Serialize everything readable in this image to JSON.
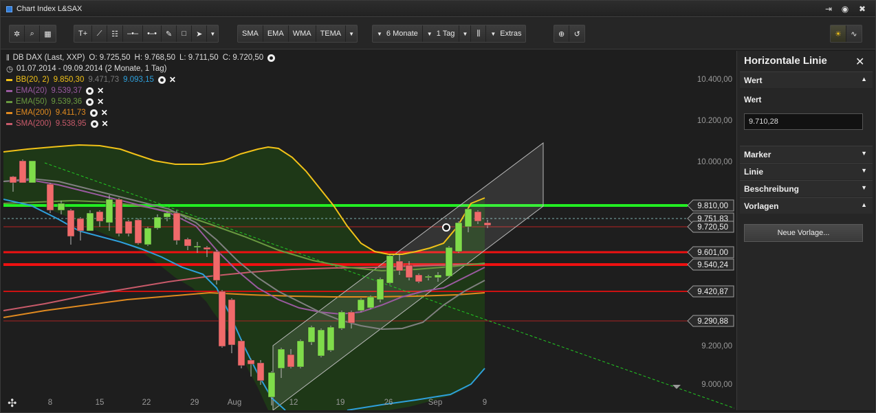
{
  "window": {
    "title": "Chart Index L&SAX",
    "buttons": [
      "export-icon",
      "target-icon",
      "close-icon"
    ]
  },
  "toolbar": {
    "tools": [
      "gear-icon",
      "search-icon",
      "grid-icon",
      "T+",
      "line-icon",
      "fibonacci-icon",
      "horizontal-line-icon",
      "ray-icon",
      "pencil-icon",
      "rectangle-icon",
      "arrow-icon"
    ],
    "indicators": [
      "SMA",
      "EMA",
      "WMA",
      "TEMA"
    ],
    "period": "6 Monate",
    "interval": "1 Tag",
    "extras": "Extras"
  },
  "legend": {
    "instrument": {
      "name": "DB DAX (Last, XXP)",
      "o": "O: 9.725,50",
      "h": "H: 9.768,50",
      "l": "L: 9.711,50",
      "c": "C: 9.720,50"
    },
    "range": "01.07.2014 - 09.09.2014 (2 Monate, 1 Tag)",
    "indicators": [
      {
        "name": "BB(20, 2)",
        "values": [
          "9.850,30",
          "9.471,73",
          "9.093,15"
        ],
        "colors": [
          "#f2c218",
          "#7a7a7a",
          "#2ea0dc"
        ],
        "color": "#f2c218"
      },
      {
        "name": "EMA(20)",
        "values": [
          "9.539,37"
        ],
        "color": "#9a5aa0"
      },
      {
        "name": "EMA(50)",
        "values": [
          "9.539,36"
        ],
        "color": "#6a9a40"
      },
      {
        "name": "EMA(200)",
        "values": [
          "9.411,73"
        ],
        "color": "#e08a20"
      },
      {
        "name": "SMA(200)",
        "values": [
          "9.538,95"
        ],
        "color": "#c85a6a"
      }
    ]
  },
  "axis": {
    "y_labels": [
      "10.400,00",
      "10.200,00",
      "10.000,00",
      "9.200,00",
      "9.000,00"
    ],
    "x_labels": [
      "8",
      "15",
      "22",
      "29",
      "Aug",
      "12",
      "19",
      "26",
      "Sep",
      "9"
    ],
    "price_tags": [
      {
        "value": "9.810,00",
        "color": "#22dd22"
      },
      {
        "value": "9.751,83",
        "color": "#888888"
      },
      {
        "value": "9.720,50",
        "color": "#888888"
      },
      {
        "value": "9.601,00",
        "color": "#ee1111"
      },
      {
        "value": "9.540,24",
        "color": "#ee1111"
      },
      {
        "value": "9.420,87",
        "color": "#ee1111"
      },
      {
        "value": "9.290,88",
        "color": "#aa2222"
      }
    ]
  },
  "panel": {
    "title": "Horizontale Linie",
    "section_wert": "Wert",
    "value_label": "Wert",
    "value": "9.710,28",
    "sections": [
      "Marker",
      "Linie",
      "Beschreibung",
      "Vorlagen"
    ],
    "button": "Neue Vorlage..."
  },
  "colors": {
    "bull": "#7fdc4a",
    "bear": "#f06a6a",
    "bb_fill": "#1f3a17"
  }
}
